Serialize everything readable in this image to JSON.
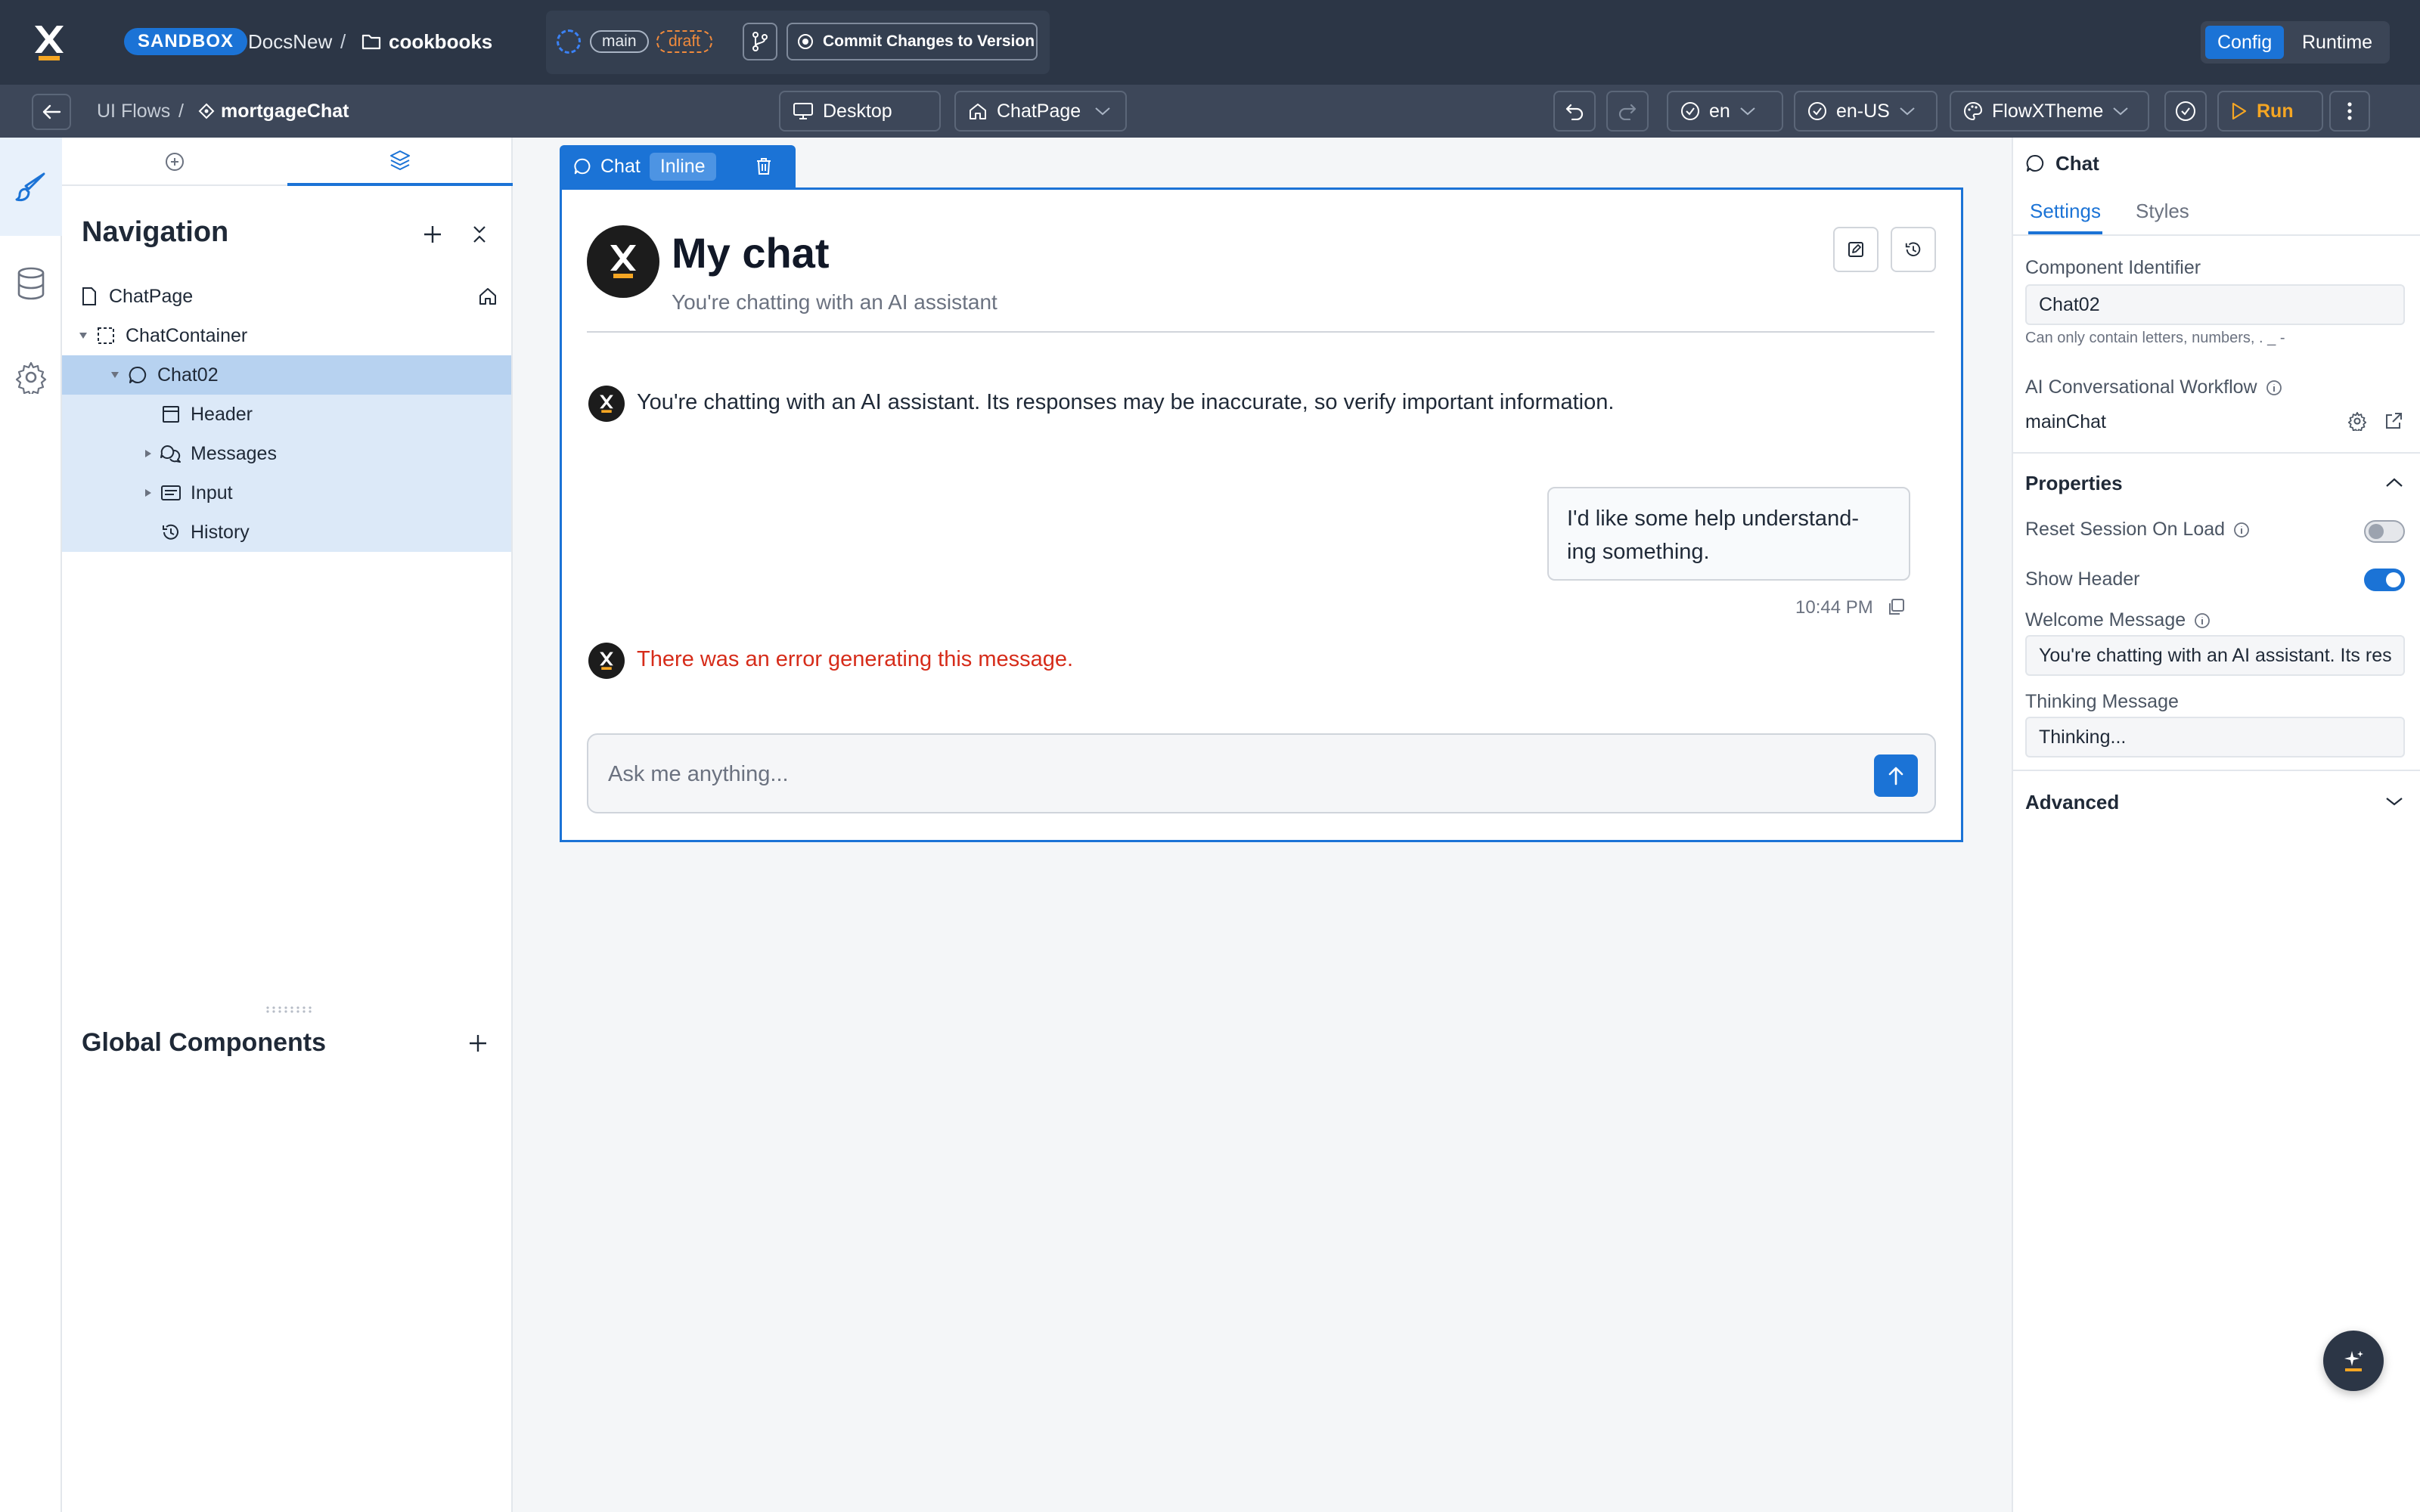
{
  "topbar": {
    "environment_badge": "SANDBOX",
    "project_name": "DocsNew",
    "separator": "/",
    "folder_name": "cookbooks",
    "branch_main": "main",
    "branch_draft": "draft",
    "commit_button": "Commit Changes to Version",
    "mode_config": "Config",
    "mode_runtime": "Runtime"
  },
  "toolbar": {
    "breadcrumb_root": "UI Flows",
    "separator": "/",
    "flow_name": "mortgageChat",
    "device": "Desktop",
    "page": "ChatPage",
    "language": "en",
    "locale": "en-US",
    "theme": "FlowXTheme",
    "run_label": "Run"
  },
  "navigation": {
    "title": "Navigation",
    "global_components_title": "Global Components",
    "tree": [
      {
        "label": "ChatPage",
        "icon": "page-icon"
      },
      {
        "label": "ChatContainer",
        "icon": "container-icon"
      },
      {
        "label": "Chat02",
        "icon": "chat-icon"
      },
      {
        "label": "Header",
        "icon": "header-icon"
      },
      {
        "label": "Messages",
        "icon": "messages-icon"
      },
      {
        "label": "Input",
        "icon": "input-icon"
      },
      {
        "label": "History",
        "icon": "history-icon"
      }
    ]
  },
  "canvas": {
    "component_tag": "Chat",
    "component_mode": "Inline",
    "chat_title": "My chat",
    "chat_subtitle": "You're chatting with an AI assistant",
    "welcome_message": "You're chatting with an AI assistant. Its responses may be inaccurate, so verify important information.",
    "user_message_line1": "I'd like some help understand-",
    "user_message_line2": "ing something.",
    "user_message_time": "10:44 PM",
    "error_message": "There was an error generating this message.",
    "input_placeholder": "Ask me anything..."
  },
  "settings_panel": {
    "component_title": "Chat",
    "tab_settings": "Settings",
    "tab_styles": "Styles",
    "identifier_label": "Component Identifier",
    "identifier_value": "Chat02",
    "identifier_hint": "Can only contain letters, numbers, . _ -",
    "workflow_label": "AI Conversational Workflow",
    "workflow_value": "mainChat",
    "properties_title": "Properties",
    "reset_session_label": "Reset Session On Load",
    "reset_session_on": false,
    "show_header_label": "Show Header",
    "show_header_on": true,
    "welcome_label": "Welcome Message",
    "welcome_value": "You're chatting with an AI assistant. Its responses may be inaccurate, so verify important information.",
    "thinking_label": "Thinking Message",
    "thinking_value": "Thinking...",
    "advanced_title": "Advanced"
  },
  "colors": {
    "accent": "#1b73d6",
    "topbar_bg": "#2c3646",
    "error": "#d62c1a",
    "draft": "#f08a3c",
    "run": "#f5a623"
  }
}
